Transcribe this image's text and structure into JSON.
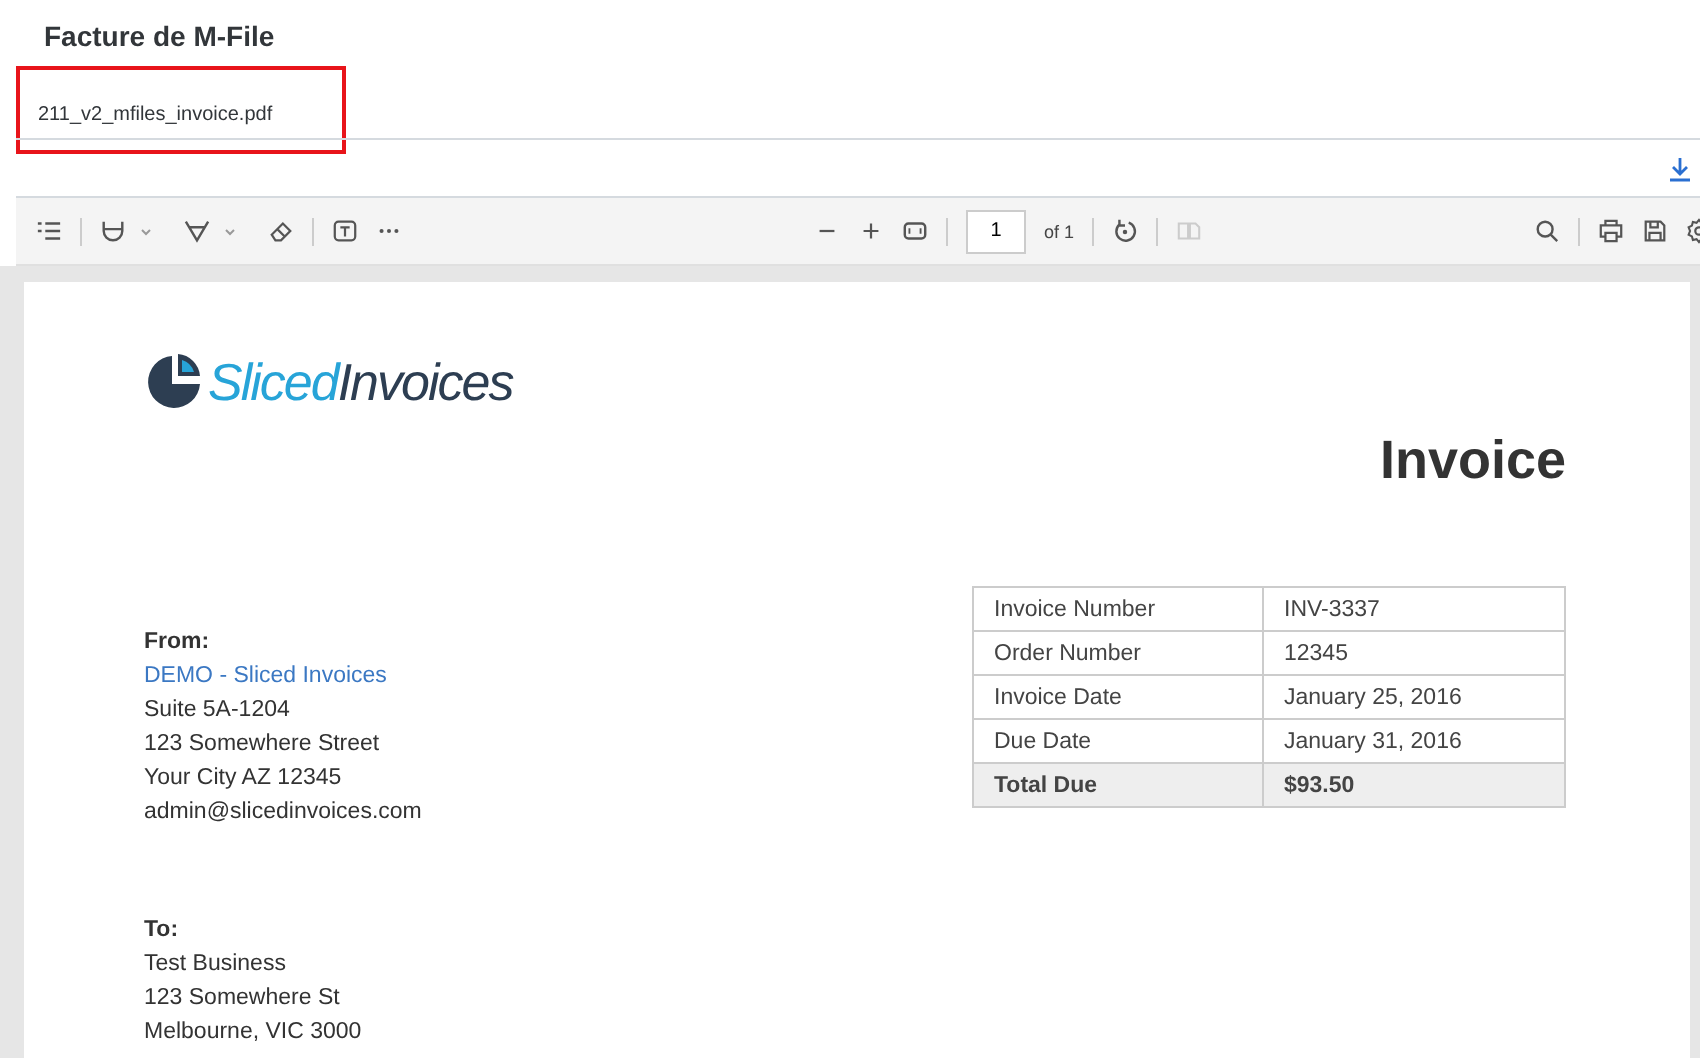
{
  "page_title": "Facture de M-File",
  "attachment": {
    "file_name": "211_v2_mfiles_invoice.pdf",
    "highlighted": true
  },
  "toolbar": {
    "page_input": "1",
    "page_count": "of 1",
    "two_page_disabled": true
  },
  "document": {
    "logo": {
      "first": "Sliced",
      "second": "Invoices"
    },
    "heading": "Invoice",
    "from": {
      "label": "From:",
      "company": "DEMO - Sliced Invoices",
      "lines": [
        "Suite 5A-1204",
        "123 Somewhere Street",
        "Your City AZ 12345",
        "admin@slicedinvoices.com"
      ]
    },
    "to": {
      "label": "To:",
      "lines": [
        "Test Business",
        "123 Somewhere St",
        "Melbourne, VIC 3000"
      ]
    },
    "details": [
      {
        "label": "Invoice Number",
        "value": "INV-3337",
        "kind": "plain"
      },
      {
        "label": "Order Number",
        "value": "12345",
        "kind": "plain"
      },
      {
        "label": "Invoice Date",
        "value": "January 25, 2016",
        "kind": "plain"
      },
      {
        "label": "Due Date",
        "value": "January 31, 2016",
        "kind": "plain"
      },
      {
        "label": "Total Due",
        "value": "$93.50",
        "kind": "total"
      }
    ]
  }
}
